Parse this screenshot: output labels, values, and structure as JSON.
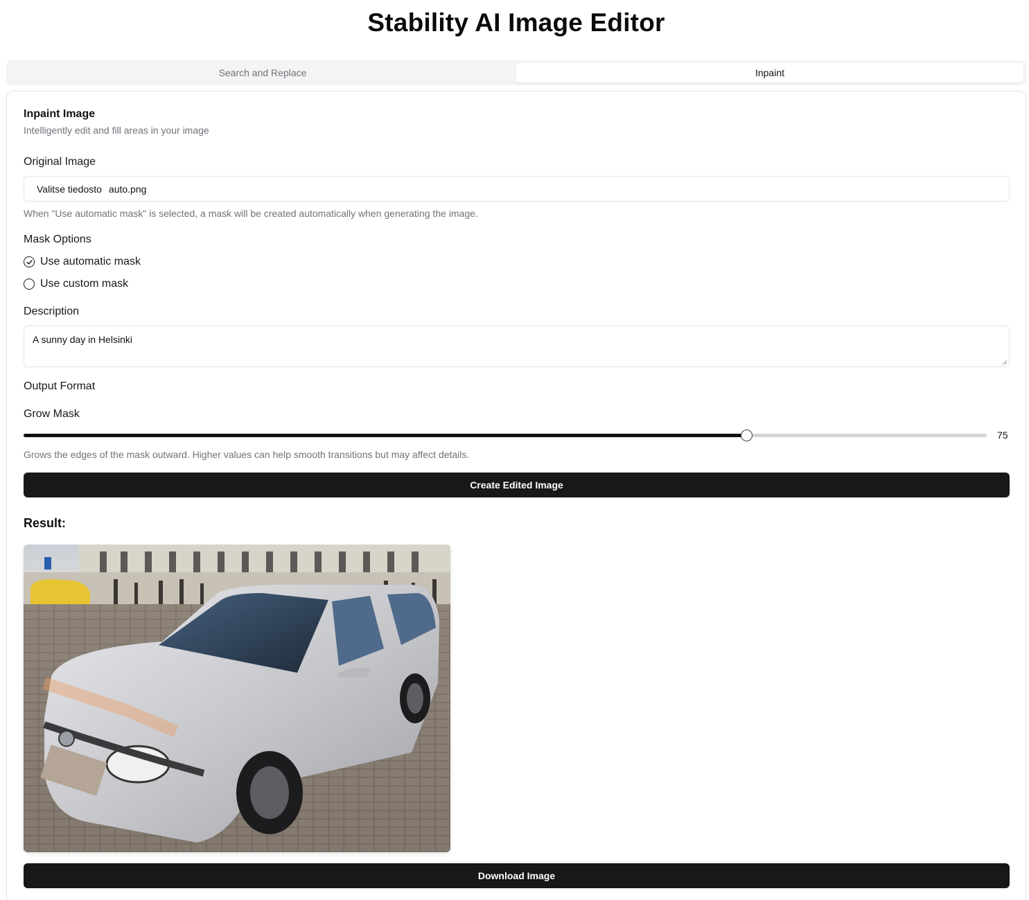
{
  "app": {
    "title": "Stability AI Image Editor"
  },
  "tabs": [
    {
      "label": "Search and Replace",
      "active": false
    },
    {
      "label": "Inpaint",
      "active": true
    }
  ],
  "card": {
    "title": "Inpaint Image",
    "description": "Intelligently edit and fill areas in your image"
  },
  "original_image": {
    "label": "Original Image",
    "button_label": "Valitse tiedosto",
    "file_name": "auto.png",
    "hint": "When \"Use automatic mask\" is selected, a mask will be created automatically when generating the image."
  },
  "mask_options": {
    "label": "Mask Options",
    "options": [
      {
        "label": "Use automatic mask",
        "selected": true
      },
      {
        "label": "Use custom mask",
        "selected": false
      }
    ]
  },
  "description_field": {
    "label": "Description",
    "value": "A sunny day in Helsinki"
  },
  "output_format": {
    "label": "Output Format"
  },
  "grow_mask": {
    "label": "Grow Mask",
    "value": 75,
    "value_text": "75",
    "min": 0,
    "max": 100,
    "hint": "Grows the edges of the mask outward. Higher values can help smooth transitions but may affect details."
  },
  "actions": {
    "create_label": "Create Edited Image",
    "download_label": "Download Image"
  },
  "result": {
    "title": "Result:"
  },
  "colors": {
    "primary_button": "#18181b",
    "muted_text": "#71717a",
    "border": "#e4e4e7",
    "tabs_bg": "#f4f4f5"
  }
}
